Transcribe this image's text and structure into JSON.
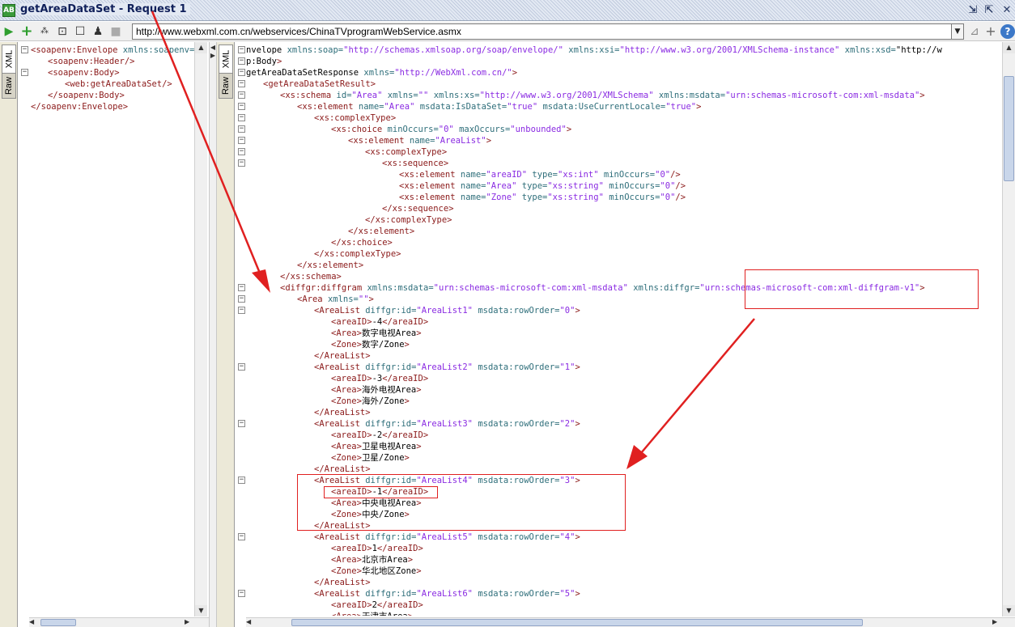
{
  "window": {
    "app_icon_text": "AB",
    "title": "getAreaDataSet - Request 1"
  },
  "toolbar": {
    "url": "http://www.webxml.com.cn/webservices/ChinaTVprogramWebService.asmx",
    "icons": [
      "run-icon",
      "add-icon",
      "format-icon",
      "zoom-icon",
      "square-icon",
      "user-icon",
      "stop-icon"
    ],
    "right_icons": [
      "filter-icon",
      "add-icon",
      "help-icon"
    ]
  },
  "left_panel": {
    "tabs": [
      "XML",
      "Raw"
    ],
    "lines": [
      {
        "indent": 0,
        "fold": "-",
        "text": "<soapenv:Envelope xmlns:soapenv=\"http://schemas.xmlsoap.org/soap/envelope/\""
      },
      {
        "indent": 1,
        "fold": "",
        "text": "<soapenv:Header/>"
      },
      {
        "indent": 1,
        "fold": "-",
        "text": "<soapenv:Body>"
      },
      {
        "indent": 2,
        "fold": "",
        "text": "<web:getAreaDataSet/>"
      },
      {
        "indent": 1,
        "fold": "",
        "text": "</soapenv:Body>"
      },
      {
        "indent": 0,
        "fold": "",
        "text": "</soapenv:Envelope>"
      }
    ]
  },
  "right_panel": {
    "tabs": [
      "XML",
      "Raw"
    ],
    "lines": [
      {
        "fold": "-",
        "indent": 0,
        "text": "nvelope xmlns:soap=\"http://schemas.xmlsoap.org/soap/envelope/\" xmlns:xsi=\"http://www.w3.org/2001/XMLSchema-instance\" xmlns:xsd=\"http://w"
      },
      {
        "fold": "-",
        "indent": 0,
        "text": "p:Body>"
      },
      {
        "fold": "-",
        "indent": 0,
        "text": "getAreaDataSetResponse xmlns=\"http://WebXml.com.cn/\">"
      },
      {
        "fold": "-",
        "indent": 1,
        "text": "<getAreaDataSetResult>"
      },
      {
        "fold": "-",
        "indent": 2,
        "text": "<xs:schema id=\"Area\" xmlns=\"\" xmlns:xs=\"http://www.w3.org/2001/XMLSchema\" xmlns:msdata=\"urn:schemas-microsoft-com:xml-msdata\">"
      },
      {
        "fold": "-",
        "indent": 3,
        "text": "<xs:element name=\"Area\" msdata:IsDataSet=\"true\" msdata:UseCurrentLocale=\"true\">"
      },
      {
        "fold": "-",
        "indent": 4,
        "text": "<xs:complexType>"
      },
      {
        "fold": "-",
        "indent": 5,
        "text": "<xs:choice minOccurs=\"0\" maxOccurs=\"unbounded\">"
      },
      {
        "fold": "-",
        "indent": 6,
        "text": "<xs:element name=\"AreaList\">"
      },
      {
        "fold": "-",
        "indent": 7,
        "text": "<xs:complexType>"
      },
      {
        "fold": "-",
        "indent": 8,
        "text": "<xs:sequence>"
      },
      {
        "fold": "",
        "indent": 9,
        "text": "<xs:element name=\"areaID\" type=\"xs:int\" minOccurs=\"0\"/>"
      },
      {
        "fold": "",
        "indent": 9,
        "text": "<xs:element name=\"Area\" type=\"xs:string\" minOccurs=\"0\"/>"
      },
      {
        "fold": "",
        "indent": 9,
        "text": "<xs:element name=\"Zone\" type=\"xs:string\" minOccurs=\"0\"/>"
      },
      {
        "fold": "",
        "indent": 8,
        "text": "</xs:sequence>"
      },
      {
        "fold": "",
        "indent": 7,
        "text": "</xs:complexType>"
      },
      {
        "fold": "",
        "indent": 6,
        "text": "</xs:element>"
      },
      {
        "fold": "",
        "indent": 5,
        "text": "</xs:choice>"
      },
      {
        "fold": "",
        "indent": 4,
        "text": "</xs:complexType>"
      },
      {
        "fold": "",
        "indent": 3,
        "text": "</xs:element>"
      },
      {
        "fold": "",
        "indent": 2,
        "text": "</xs:schema>"
      },
      {
        "fold": "-",
        "indent": 2,
        "text": "<diffgr:diffgram xmlns:msdata=\"urn:schemas-microsoft-com:xml-msdata\" xmlns:diffgr=\"urn:schemas-microsoft-com:xml-diffgram-v1\">"
      },
      {
        "fold": "-",
        "indent": 3,
        "text": "<Area xmlns=\"\">"
      },
      {
        "fold": "-",
        "indent": 4,
        "text": "<AreaList diffgr:id=\"AreaList1\" msdata:rowOrder=\"0\">"
      },
      {
        "fold": "",
        "indent": 5,
        "text": "<areaID>-4</areaID>"
      },
      {
        "fold": "",
        "indent": 5,
        "text": "<Area>数字电视Area>"
      },
      {
        "fold": "",
        "indent": 5,
        "text": "<Zone>数字/Zone>"
      },
      {
        "fold": "",
        "indent": 4,
        "text": "</AreaList>"
      },
      {
        "fold": "-",
        "indent": 4,
        "text": "<AreaList diffgr:id=\"AreaList2\" msdata:rowOrder=\"1\">"
      },
      {
        "fold": "",
        "indent": 5,
        "text": "<areaID>-3</areaID>"
      },
      {
        "fold": "",
        "indent": 5,
        "text": "<Area>海外电视Area>"
      },
      {
        "fold": "",
        "indent": 5,
        "text": "<Zone>海外/Zone>"
      },
      {
        "fold": "",
        "indent": 4,
        "text": "</AreaList>"
      },
      {
        "fold": "-",
        "indent": 4,
        "text": "<AreaList diffgr:id=\"AreaList3\" msdata:rowOrder=\"2\">"
      },
      {
        "fold": "",
        "indent": 5,
        "text": "<areaID>-2</areaID>"
      },
      {
        "fold": "",
        "indent": 5,
        "text": "<Area>卫星电视Area>"
      },
      {
        "fold": "",
        "indent": 5,
        "text": "<Zone>卫星/Zone>"
      },
      {
        "fold": "",
        "indent": 4,
        "text": "</AreaList>"
      },
      {
        "fold": "-",
        "indent": 4,
        "text": "<AreaList diffgr:id=\"AreaList4\" msdata:rowOrder=\"3\">"
      },
      {
        "fold": "",
        "indent": 5,
        "text": "<areaID>-1</areaID>"
      },
      {
        "fold": "",
        "indent": 5,
        "text": "<Area>中央电视Area>"
      },
      {
        "fold": "",
        "indent": 5,
        "text": "<Zone>中央/Zone>"
      },
      {
        "fold": "",
        "indent": 4,
        "text": "</AreaList>"
      },
      {
        "fold": "-",
        "indent": 4,
        "text": "<AreaList diffgr:id=\"AreaList5\" msdata:rowOrder=\"4\">"
      },
      {
        "fold": "",
        "indent": 5,
        "text": "<areaID>1</areaID>"
      },
      {
        "fold": "",
        "indent": 5,
        "text": "<Area>北京市Area>"
      },
      {
        "fold": "",
        "indent": 5,
        "text": "<Zone>华北地区Zone>"
      },
      {
        "fold": "",
        "indent": 4,
        "text": "</AreaList>"
      },
      {
        "fold": "-",
        "indent": 4,
        "text": "<AreaList diffgr:id=\"AreaList6\" msdata:rowOrder=\"5\">"
      },
      {
        "fold": "",
        "indent": 5,
        "text": "<areaID>2</areaID>"
      },
      {
        "fold": "",
        "indent": 5,
        "text": "<Area>天津市Area>"
      }
    ]
  },
  "colors": {
    "tag": "#8b1a1a",
    "attr_name": "#2e6e7a",
    "attr_value": "#8a2be2",
    "text": "#000000",
    "annotation_red": "#e02020"
  }
}
